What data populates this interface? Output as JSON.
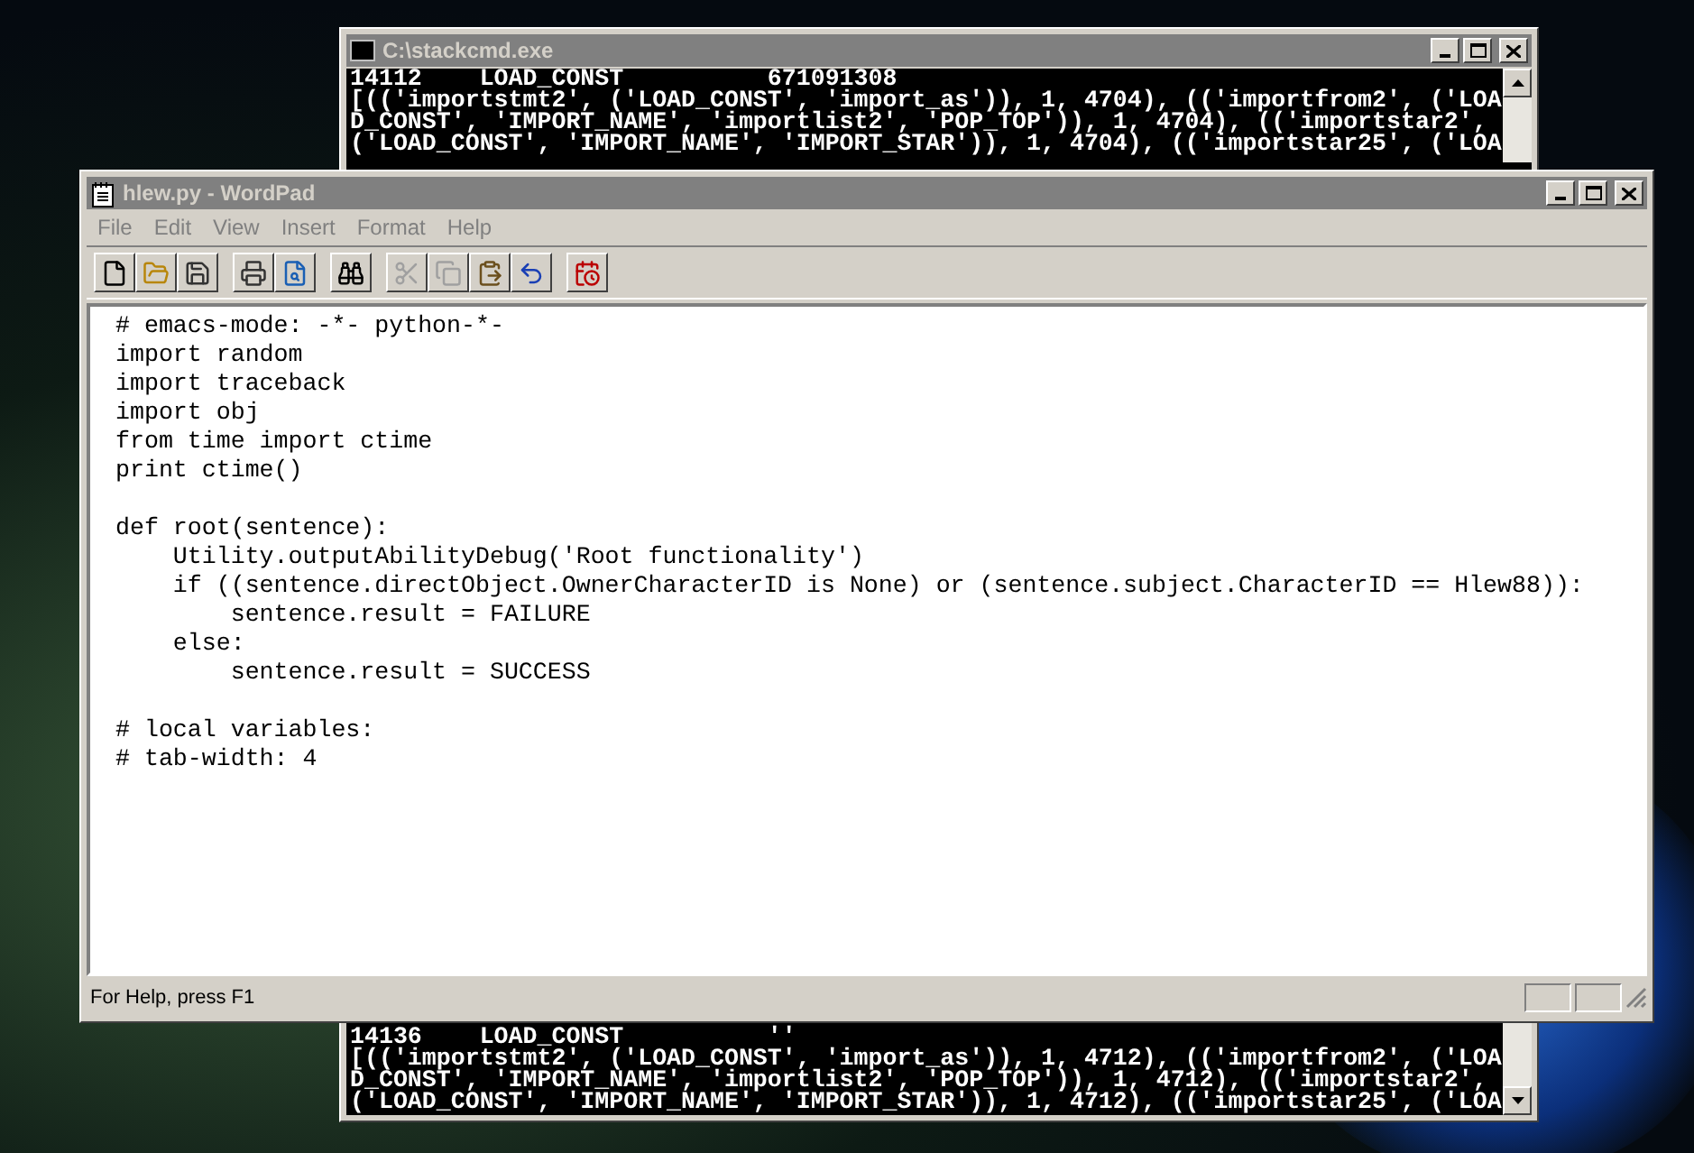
{
  "console": {
    "title": "C:\\stackcmd.exe",
    "top_lines": [
      "14112    LOAD_CONST          671091308",
      "[(('importstmt2', ('LOAD_CONST', 'import_as')), 1, 4704), (('importfrom2', ('LOA",
      "D_CONST', 'IMPORT_NAME', 'importlist2', 'POP_TOP')), 1, 4704), (('importstar2',",
      "('LOAD_CONST', 'IMPORT_NAME', 'IMPORT_STAR')), 1, 4704), (('importstar25', ('LOA"
    ],
    "bottom_lines": [
      "14136    LOAD_CONST          ''",
      "[(('importstmt2', ('LOAD_CONST', 'import_as')), 1, 4712), (('importfrom2', ('LOA",
      "D_CONST', 'IMPORT_NAME', 'importlist2', 'POP_TOP')), 1, 4712), (('importstar2',",
      "('LOAD_CONST', 'IMPORT_NAME', 'IMPORT_STAR')), 1, 4712), (('importstar25', ('LOA"
    ]
  },
  "wordpad": {
    "title": "hlew.py - WordPad",
    "menu": [
      "File",
      "Edit",
      "View",
      "Insert",
      "Format",
      "Help"
    ],
    "toolbar": [
      [
        {
          "kind": "new",
          "disabled": false
        },
        {
          "kind": "open",
          "disabled": false
        },
        {
          "kind": "save",
          "disabled": false
        }
      ],
      [
        {
          "kind": "print",
          "disabled": false
        },
        {
          "kind": "preview",
          "disabled": false
        }
      ],
      [
        {
          "kind": "find",
          "disabled": false
        }
      ],
      [
        {
          "kind": "cut",
          "disabled": true
        },
        {
          "kind": "copy",
          "disabled": true
        },
        {
          "kind": "paste",
          "disabled": false
        },
        {
          "kind": "undo",
          "disabled": false
        }
      ],
      [
        {
          "kind": "datetime",
          "disabled": false
        }
      ]
    ],
    "document": [
      [
        "# emacs-mode: -*- python-*-",
        "import random",
        "import traceback",
        "import obj",
        "from time import ctime",
        "print ctime()"
      ],
      [
        "def root(sentence):",
        "    Utility.outputAbilityDebug('Root functionality')",
        "    if ((sentence.directObject.OwnerCharacterID is None) or (sentence.subject.CharacterID == Hlew88)):",
        "        sentence.result = FAILURE",
        "    else:",
        "        sentence.result = SUCCESS"
      ],
      [
        "# local variables:",
        "# tab-width: 4"
      ]
    ],
    "status_bar": "For Help, press F1"
  }
}
